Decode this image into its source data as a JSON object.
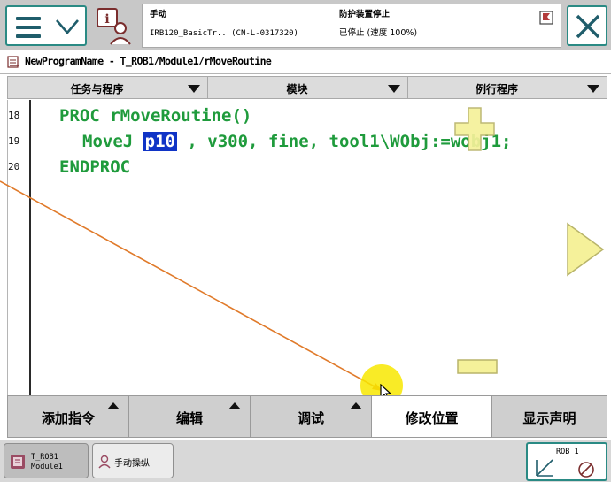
{
  "status": {
    "mode": "手动",
    "controller": "IRB120_BasicTr.. (CN-L-0317320)",
    "guard": "防护装置停止",
    "speed": "已停止 (速度 100%)"
  },
  "path": {
    "title": "NewProgramName - T_ROB1/Module1/rMoveRoutine"
  },
  "tabs": [
    {
      "label": "任务与程序"
    },
    {
      "label": "模块"
    },
    {
      "label": "例行程序"
    }
  ],
  "editor": {
    "lines": [
      {
        "num": "18",
        "text": "PROC rMoveRoutine()"
      },
      {
        "num": "19",
        "pre": "MoveJ ",
        "selected": "p10",
        "post": " , v300, fine, tool1\\WObj:=wobj1;"
      },
      {
        "num": "20",
        "text": "ENDPROC"
      }
    ]
  },
  "commands": [
    {
      "label": "添加指令"
    },
    {
      "label": "编辑"
    },
    {
      "label": "调试"
    },
    {
      "label": "修改位置"
    },
    {
      "label": "显示声明"
    }
  ],
  "taskbar": {
    "task1_line1": "T_ROB1",
    "task1_line2": "Module1",
    "task2_label": "手动操纵",
    "quickset_label": "ROB_1"
  },
  "colors": {
    "accent": "#2a8a84",
    "code": "#1f9b3c",
    "selection": "#1034c6",
    "zoom": "#f5f19a"
  }
}
